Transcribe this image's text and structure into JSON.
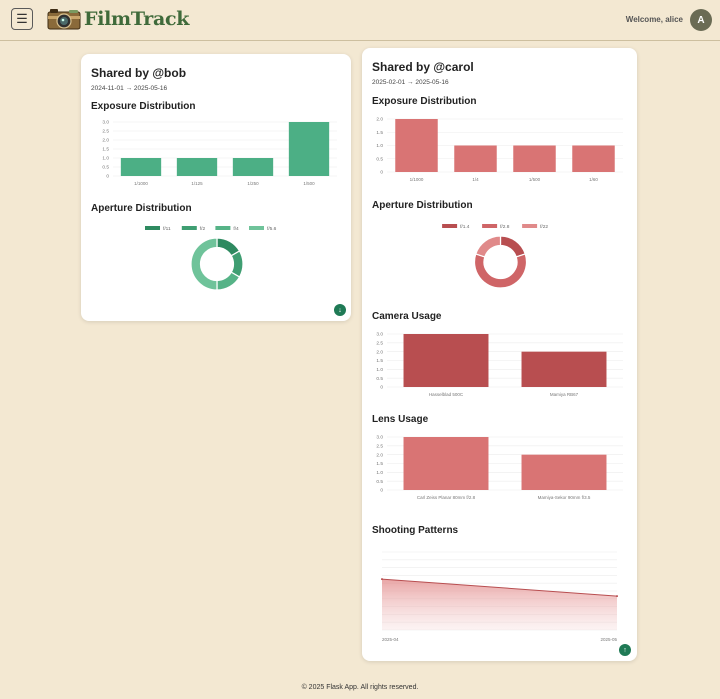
{
  "app": {
    "name": "FilmTrack",
    "menu_icon": "hamburger-icon",
    "logo_icon": "camera-icon"
  },
  "user": {
    "welcome": "Welcome, alice",
    "avatar_initial": "A"
  },
  "footer": "© 2025 Flask App. All rights reserved.",
  "colors": {
    "bob_primary": "#4caf85",
    "carol_primary": "#d97474",
    "carol_dark": "#b84e50",
    "accent": "#1f7a55"
  },
  "bob": {
    "title": "Shared by @bob",
    "dates": "2024-11-01 → 2025-05-16",
    "exposure_title": "Exposure Distribution",
    "aperture_title": "Aperture Distribution",
    "fab_icon": "arrow-down-icon",
    "fab_glyph": "↓"
  },
  "carol": {
    "title": "Shared by @carol",
    "dates": "2025-02-01 → 2025-05-16",
    "exposure_title": "Exposure Distribution",
    "aperture_title": "Aperture Distribution",
    "camera_title": "Camera Usage",
    "lens_title": "Lens Usage",
    "patterns_title": "Shooting Patterns",
    "fab_icon": "arrow-up-icon",
    "fab_glyph": "↑"
  },
  "chart_data": [
    {
      "id": "bob-exposure",
      "type": "bar",
      "title": "Exposure Distribution",
      "categories": [
        "1/1000",
        "1/125",
        "1/250",
        "1/500"
      ],
      "values": [
        1,
        1,
        1,
        3
      ],
      "ylim": [
        0,
        3
      ],
      "yticks": [
        "0",
        "0.5",
        "1.0",
        "1.5",
        "2.0",
        "2.5",
        "3.0"
      ],
      "grid": true
    },
    {
      "id": "bob-aperture",
      "type": "pie",
      "title": "Aperture Distribution",
      "categories": [
        "f/11",
        "f/2",
        "f/4",
        "f/5.6"
      ],
      "values": [
        1,
        1,
        1,
        3
      ],
      "colors": [
        "#2e8a60",
        "#3f9e72",
        "#56b387",
        "#6fc39a"
      ],
      "legend": "top"
    },
    {
      "id": "carol-exposure",
      "type": "bar",
      "title": "Exposure Distribution",
      "categories": [
        "1/1000",
        "1/4",
        "1/500",
        "1/60"
      ],
      "values": [
        2,
        1,
        1,
        1
      ],
      "ylim": [
        0,
        2
      ],
      "yticks": [
        "0",
        "0.5",
        "1.0",
        "1.5",
        "2.0"
      ],
      "grid": true
    },
    {
      "id": "carol-aperture",
      "type": "pie",
      "title": "Aperture Distribution",
      "categories": [
        "f/1.4",
        "f/2.8",
        "f/22"
      ],
      "values": [
        1,
        3,
        1
      ],
      "colors": [
        "#b84e50",
        "#cf6567",
        "#e08a8a"
      ],
      "legend": "top"
    },
    {
      "id": "carol-camera",
      "type": "bar",
      "title": "Camera Usage",
      "categories": [
        "Hasselblad 500C",
        "Mamiya RB67"
      ],
      "values": [
        3,
        2
      ],
      "ylim": [
        0,
        3
      ],
      "yticks": [
        "0",
        "0.5",
        "1.0",
        "1.5",
        "2.0",
        "2.5",
        "3.0"
      ],
      "grid": true
    },
    {
      "id": "carol-lens",
      "type": "bar",
      "title": "Lens Usage",
      "categories": [
        "Carl Zeiss Planar 80mm f/2.8",
        "Mamiya-Sekor 90mm f/3.5"
      ],
      "values": [
        3,
        2
      ],
      "ylim": [
        0,
        3
      ],
      "yticks": [
        "0",
        "0.5",
        "1.0",
        "1.5",
        "2.0",
        "2.5",
        "3.0"
      ],
      "grid": true
    },
    {
      "id": "carol-patterns",
      "type": "area",
      "title": "Shooting Patterns",
      "x": [
        "2025-04",
        "2025-05"
      ],
      "values": [
        3,
        2
      ],
      "ylim": [
        0,
        4.6
      ],
      "grid": true
    }
  ]
}
